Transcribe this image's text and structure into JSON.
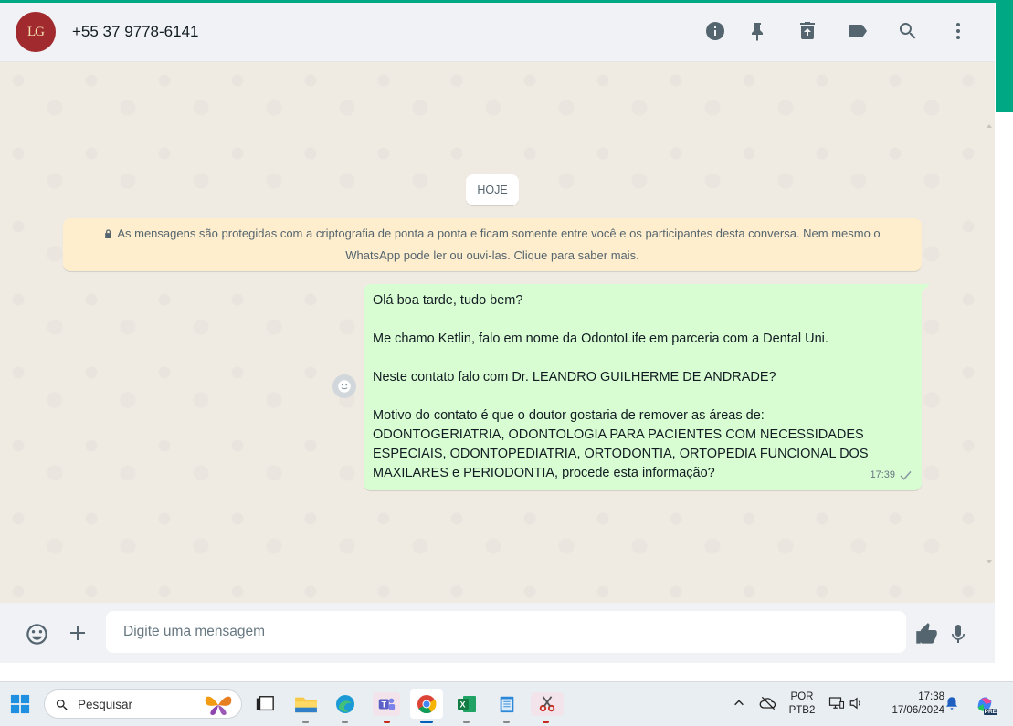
{
  "header": {
    "avatar_text": "LG",
    "contact_name": "+55 37 9778-6141",
    "icons": [
      "info-icon",
      "pin-icon",
      "delete-icon",
      "label-icon",
      "search-icon",
      "menu-icon"
    ]
  },
  "chat": {
    "date_chip": "HOJE",
    "encryption_notice": "As mensagens são protegidas com a criptografia de ponta a ponta e ficam somente entre você e os participantes desta conversa. Nem mesmo o WhatsApp pode ler ou ouvi-las. Clique para saber mais.",
    "message": {
      "lines": [
        "Olá boa tarde, tudo bem?",
        "",
        "Me chamo Ketlin, falo em nome da OdontoLife em parceria com a Dental Uni.",
        "",
        "Neste contato falo com Dr. LEANDRO GUILHERME DE ANDRADE?",
        "",
        "Motivo do contato é que o doutor gostaria de remover as áreas de:",
        "ODONTOGERIATRIA, ODONTOLOGIA PARA PACIENTES COM NECESSIDADES",
        "ESPECIAIS, ODONTOPEDIATRIA, ORTODONTIA, ORTOPEDIA FUNCIONAL DOS",
        "MAXILARES e PERIODONTIA, procede esta informação?"
      ],
      "time": "17:39",
      "status": "sent-check"
    }
  },
  "composer": {
    "placeholder": "Digite uma mensagem",
    "value": ""
  },
  "taskbar": {
    "search_label": "Pesquisar",
    "lang_top": "POR",
    "lang_bottom": "PTB2",
    "clock_time": "17:38",
    "clock_date": "17/06/2024",
    "copilot_badge": "PRE"
  },
  "colors": {
    "accent": "#00a884",
    "bubble_out": "#d9fdd3",
    "notice_bg": "#ffeecd",
    "chat_bg": "#efeae2"
  }
}
